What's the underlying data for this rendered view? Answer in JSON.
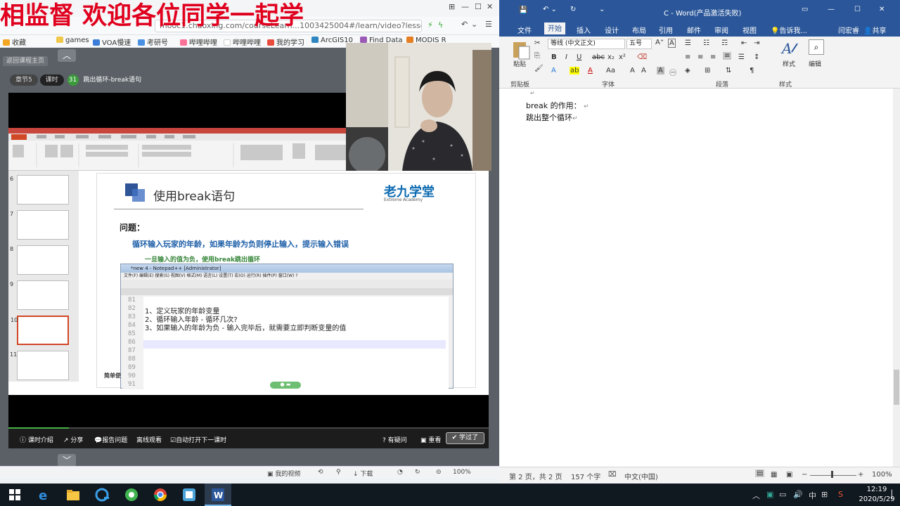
{
  "banner": {
    "text": "相监督 欢迎各位同学一起学"
  },
  "browser": {
    "url": "mooc1.chaoxing.com/courseLearn...1003425004#/learn/video?lesso",
    "bookmarks": [
      "收藏",
      "games",
      "VOA慢速",
      "考研号",
      "哔哩哔哩",
      "哔哩哔哩",
      "我的学习",
      "ArcGIS10",
      "Find Data",
      "MODIS R"
    ],
    "back_label": "返回课程主页",
    "chapter": {
      "section": "章节5",
      "lesson_tag": "课时",
      "lesson_num": "31",
      "lesson_title": "跳出循环-break语句"
    }
  },
  "slide": {
    "title": "使用break语句",
    "logo": "老九学堂",
    "logo_sub": "Extreme Academy",
    "question_head": "问题：",
    "line1": "循环输入玩家的年龄，如果年龄为负则停止输入，提示输入错误",
    "line2": "一旦输入的值为负，使用break跳出循环",
    "notepad_title": "*new 4 - Notepad++ [Administrator]",
    "notepad_menu": "文件(F)  编辑(E)  搜索(S)  视图(V)  格式(M)  语言(L)  设置(T)  宏(O)  运行(R)  插件(P)  窗口(W)  ?",
    "line_numbers": [
      "81",
      "82",
      "83",
      "84",
      "85",
      "86",
      "87",
      "88",
      "89",
      "90",
      "91"
    ],
    "code_lines": [
      "",
      "1、定义玩家的年龄变量",
      "2、循环输入年龄 - 循环几次?",
      "3、如果输入的年龄为负 - 输入完毕后，就需要立即判断变量的值",
      "",
      "",
      "",
      "",
      "",
      "",
      ""
    ],
    "thumb_numbers": [
      "6",
      "7",
      "8",
      "9",
      "10",
      "11"
    ],
    "bottom_label": "简单使"
  },
  "controls": {
    "intro": "课时介绍",
    "share": "分享",
    "report": "报告问题",
    "offline": "离线观看",
    "autoplay": "自动打开下一课时",
    "help": "有疑问",
    "replay": "重看",
    "learned": "学过了"
  },
  "browser_status": {
    "my_video": "我的视频",
    "download": "下载",
    "zoom": "100%"
  },
  "word": {
    "title": "C - Word(产品激活失败)",
    "tabs": [
      "文件",
      "开始",
      "插入",
      "设计",
      "布局",
      "引用",
      "邮件",
      "审阅",
      "视图"
    ],
    "tell_me": "告诉我...",
    "user": "闫宏睿",
    "share": "共享",
    "paste": "粘贴",
    "font_name": "等线 (中文正文)",
    "font_size": "五号",
    "styles": "样式",
    "edit": "编辑",
    "groups": [
      "剪贴板",
      "字体",
      "段落",
      "样式"
    ],
    "doc_line1": "break 的作用：",
    "doc_line2": "跳出整个循环",
    "status_page": "第 2 页，共 2 页",
    "status_words": "157 个字",
    "status_lang": "中文(中国)",
    "status_zoom": "100%"
  },
  "taskbar": {
    "time": "12:19",
    "date": "2020/5/29"
  }
}
